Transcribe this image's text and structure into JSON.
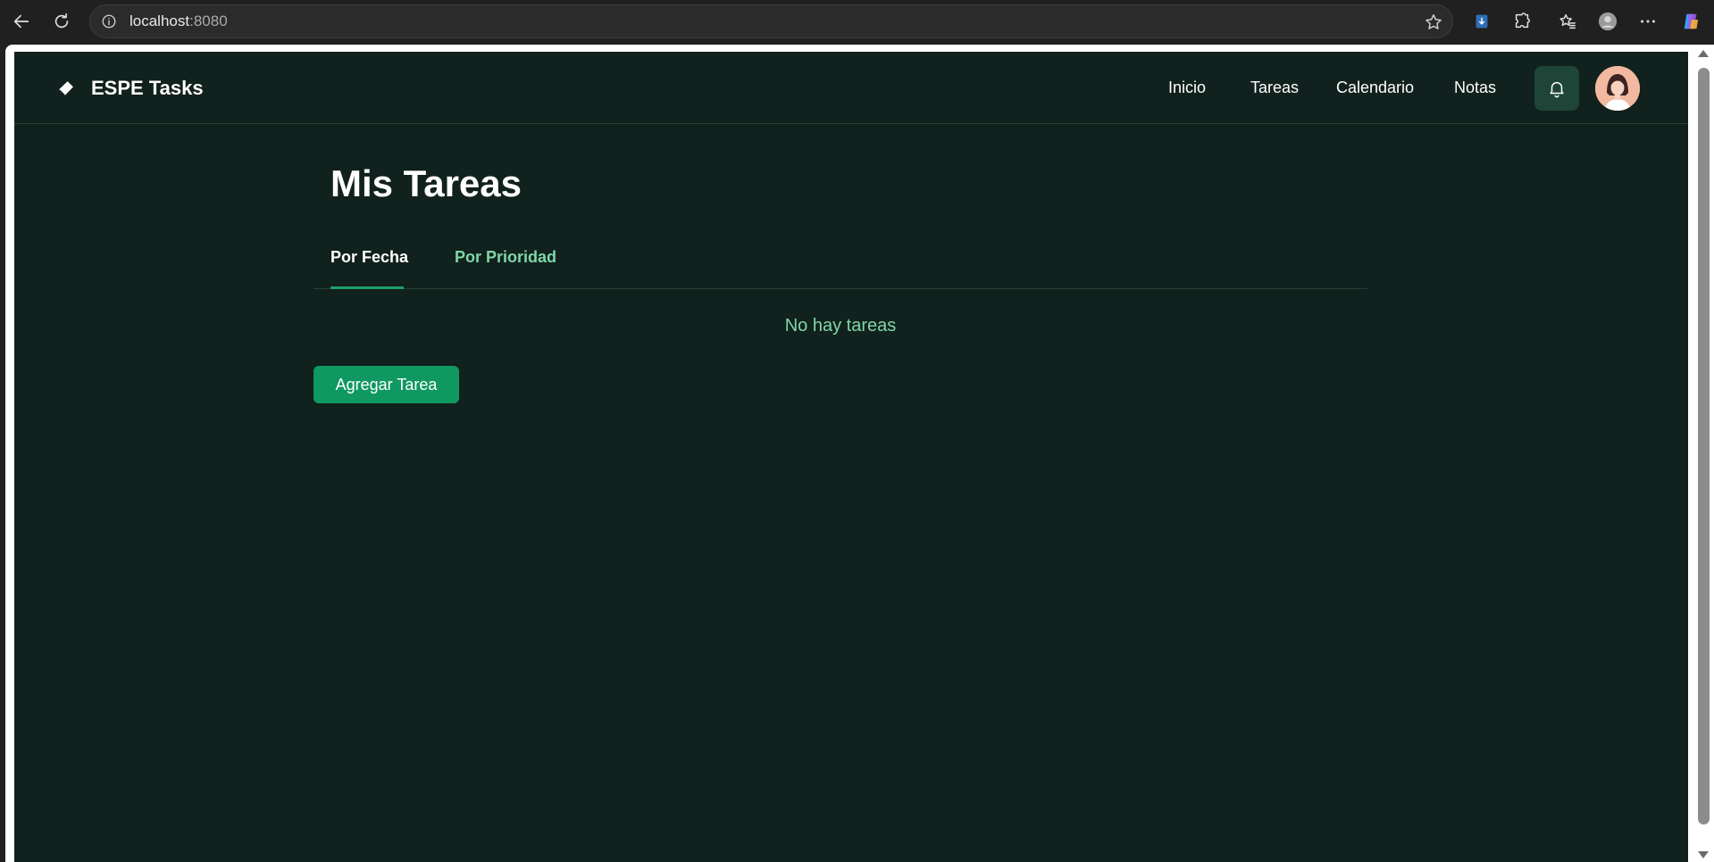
{
  "browser": {
    "url_host": "localhost",
    "url_port": ":8080"
  },
  "header": {
    "brand": "ESPE Tasks",
    "nav": [
      "Inicio",
      "Tareas",
      "Calendario",
      "Notas"
    ]
  },
  "main": {
    "title": "Mis Tareas",
    "tabs": [
      {
        "label": "Por Fecha",
        "active": true
      },
      {
        "label": "Por Prioridad",
        "active": false
      }
    ],
    "empty_message": "No hay tareas",
    "add_button_label": "Agregar Tarea"
  },
  "colors": {
    "background": "#11211d",
    "accent": "#0f9960",
    "accent_text": "#7fd6a8"
  },
  "icons": [
    "back-icon",
    "reload-icon",
    "info-icon",
    "star-icon",
    "extension-icon",
    "puzzle-icon",
    "favorites-icon",
    "profile-icon",
    "more-icon",
    "copilot-icon",
    "brand-icon",
    "bell-icon"
  ]
}
